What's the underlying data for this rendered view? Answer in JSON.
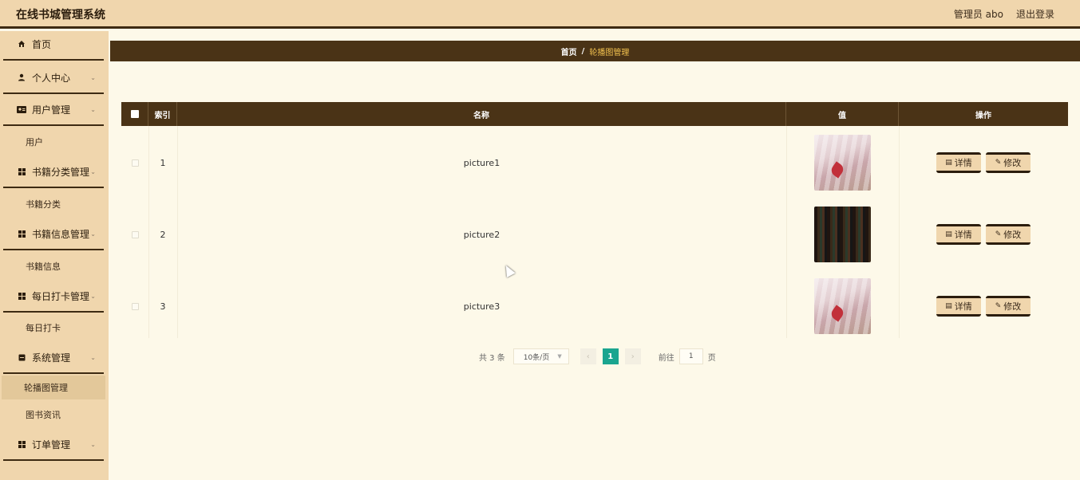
{
  "header": {
    "app_title": "在线书城管理系统",
    "user_label": "管理员 abo",
    "logout_label": "退出登录"
  },
  "sidebar": {
    "items": [
      {
        "label": "首页",
        "icon": "home-icon",
        "has_children": false
      },
      {
        "label": "个人中心",
        "icon": "person-icon",
        "has_children": true
      },
      {
        "label": "用户管理",
        "icon": "id-card-icon",
        "has_children": true,
        "children": [
          "用户"
        ]
      },
      {
        "label": "书籍分类管理",
        "icon": "grid-icon",
        "has_children": true,
        "children": [
          "书籍分类"
        ]
      },
      {
        "label": "书籍信息管理",
        "icon": "grid-icon",
        "has_children": true,
        "children": [
          "书籍信息"
        ]
      },
      {
        "label": "每日打卡管理",
        "icon": "grid-icon",
        "has_children": true,
        "children": [
          "每日打卡"
        ]
      },
      {
        "label": "系统管理",
        "icon": "book-icon",
        "has_children": true,
        "children": [
          "轮播图管理",
          "图书资讯"
        ]
      },
      {
        "label": "订单管理",
        "icon": "grid-icon",
        "has_children": true
      }
    ],
    "active_sub": "轮播图管理"
  },
  "breadcrumb": {
    "home": "首页",
    "separator": "/",
    "current": "轮播图管理"
  },
  "table": {
    "columns": [
      "",
      "索引",
      "名称",
      "值",
      "操作"
    ],
    "rows": [
      {
        "index": "1",
        "name": "picture1",
        "image": "book-with-red-leaf"
      },
      {
        "index": "2",
        "name": "picture2",
        "image": "bookshelf"
      },
      {
        "index": "3",
        "name": "picture3",
        "image": "book-with-red-leaf"
      }
    ],
    "detail_label": "详情",
    "edit_label": "修改"
  },
  "pagination": {
    "total_text": "共 3 条",
    "page_size": "10条/页",
    "current_page": "1",
    "goto_label": "前往",
    "goto_value": "1",
    "page_suffix": "页"
  },
  "colors": {
    "header_bg": "#f0d6ad",
    "dark_brown": "#4a3316",
    "page_bg": "#fdf9e9",
    "accent_gold": "#f3c24f",
    "pager_active": "#1aa58f"
  }
}
